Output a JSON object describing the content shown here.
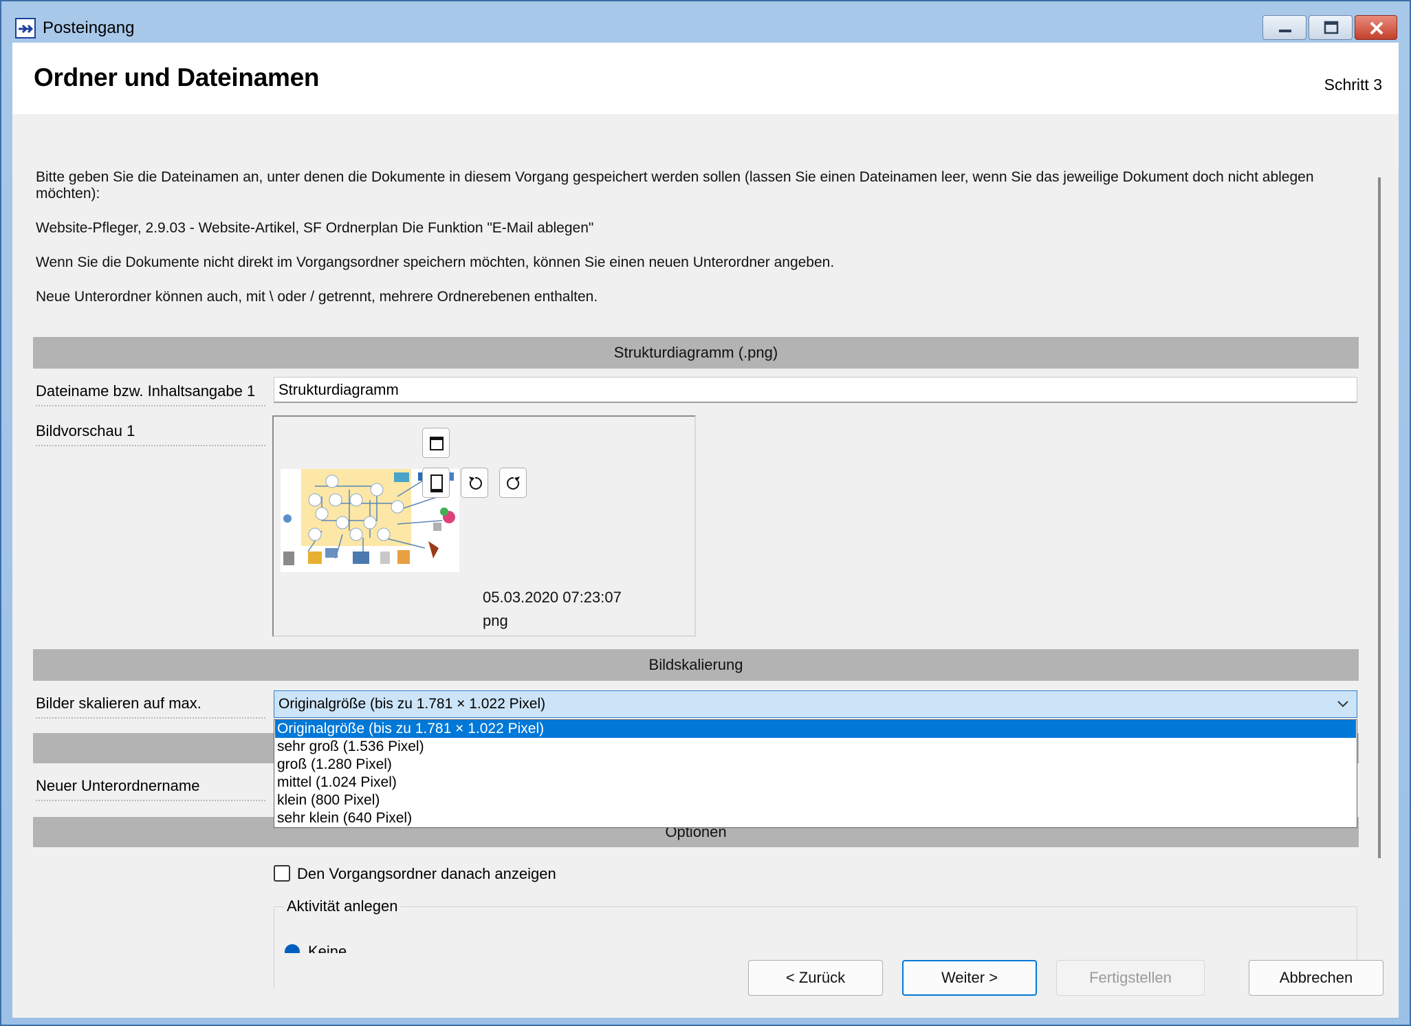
{
  "window": {
    "title": "Posteingang",
    "app_icon": "arrow-into-box-icon",
    "controls": [
      "minimize-icon",
      "maximize-icon",
      "close-icon"
    ]
  },
  "header": {
    "title": "Ordner und Dateinamen",
    "step": "Schritt 3"
  },
  "intro": {
    "p1": "Bitte geben Sie die Dateinamen an, unter denen die Dokumente in diesem Vorgang gespeichert werden sollen (lassen Sie einen Dateinamen leer, wenn Sie das jeweilige Dokument doch nicht ablegen  möchten):",
    "p2": "Website-Pfleger, 2.9.03 - Website-Artikel, SF Ordnerplan Die Funktion \"E-Mail ablegen\"",
    "p3": "Wenn Sie die Dokumente nicht direkt im Vorgangsordner speichern möchten, können Sie einen neuen Unterordner angeben.",
    "p4": "Neue Unterordner können auch, mit \\ oder / getrennt, mehrere Ordnerebenen enthalten."
  },
  "document_section": {
    "header": "Strukturdiagramm (.png)",
    "filename_label": "Dateiname bzw. Inhaltsangabe 1",
    "filename_value": "Strukturdiagramm",
    "preview_label": "Bildvorschau 1",
    "preview_buttons": [
      "window-icon",
      "portrait-page-icon",
      "rotate-left-icon",
      "rotate-right-icon"
    ],
    "date": "05.03.2020 07:23:07",
    "file_type": "png"
  },
  "scaling_section": {
    "header": "Bildskalierung",
    "label": "Bilder skalieren auf max.",
    "selected": "Originalgröße (bis zu 1.781 × 1.022 Pixel)",
    "options": [
      "Originalgröße (bis zu 1.781 × 1.022 Pixel)",
      "sehr groß (1.536 Pixel)",
      "groß (1.280 Pixel)",
      "mittel (1.024 Pixel)",
      "klein (800 Pixel)",
      "sehr klein (640 Pixel)"
    ]
  },
  "subfolder": {
    "label": "Neuer Unterordnername"
  },
  "options_section": {
    "header": "Optionen",
    "checkbox_label": "Den Vorgangsordner danach anzeigen",
    "checkbox_checked": false,
    "group_title": "Aktivität anlegen",
    "radio_label": "Keine"
  },
  "buttons": {
    "back": "< Zurück",
    "next": "Weiter >",
    "finish": "Fertigstellen",
    "cancel": "Abbrechen"
  },
  "colors": {
    "accent": "#0078d7",
    "section_bar": "#b3b3b3",
    "title_bar": "#a8c8ea"
  }
}
